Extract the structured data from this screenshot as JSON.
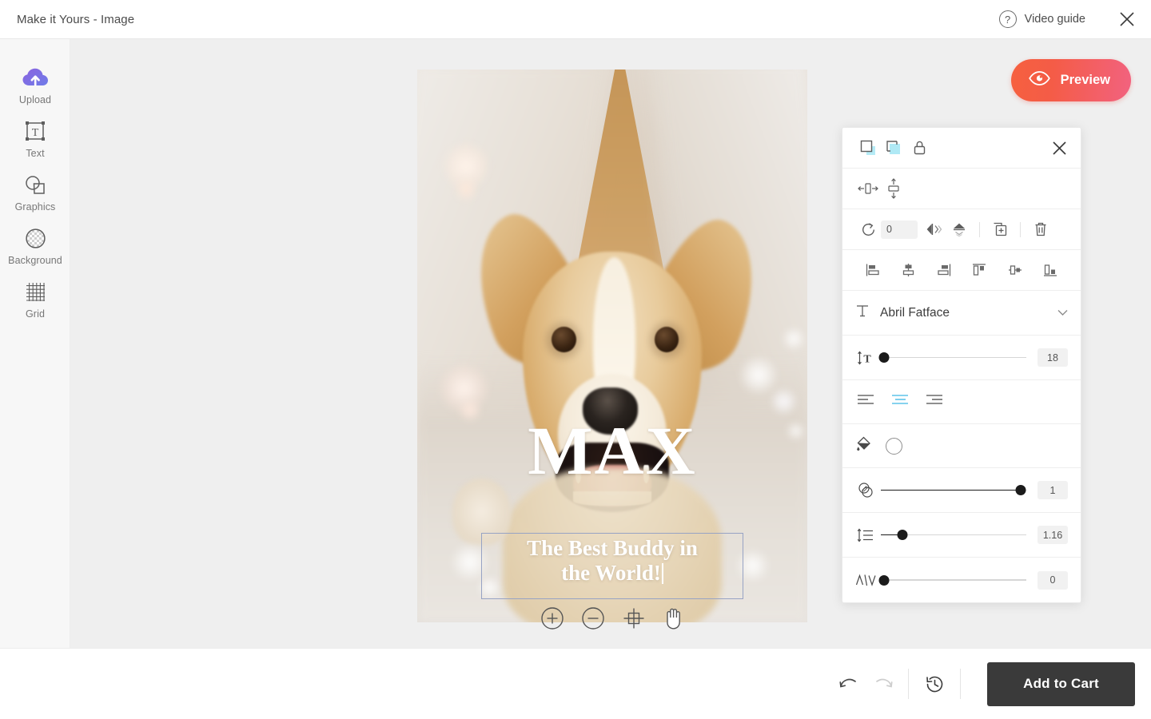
{
  "header": {
    "title": "Make it Yours - Image",
    "video_guide_label": "Video guide",
    "help_icon": "question-mark-icon",
    "close_icon": "close-icon"
  },
  "sidebar": {
    "items": [
      {
        "label": "Upload",
        "icon": "cloud-upload-icon"
      },
      {
        "label": "Text",
        "icon": "text-box-icon"
      },
      {
        "label": "Graphics",
        "icon": "shapes-icon"
      },
      {
        "label": "Background",
        "icon": "transparency-circle-icon"
      },
      {
        "label": "Grid",
        "icon": "grid-icon"
      }
    ]
  },
  "preview": {
    "label": "Preview",
    "icon": "eye-icon"
  },
  "canvas": {
    "image_alt": "corgi-dog-photo",
    "title_text": "MAX",
    "subtitle_line1": "The Best Buddy in",
    "subtitle_line2": "the World!",
    "selection_border_color": "#97a3c4",
    "tools": [
      {
        "name": "zoom-in-icon",
        "label": "+"
      },
      {
        "name": "zoom-out-icon",
        "label": "−"
      },
      {
        "name": "fit-canvas-icon",
        "label": ""
      },
      {
        "name": "pan-hand-icon",
        "label": ""
      }
    ]
  },
  "panel": {
    "close_icon": "close-icon",
    "mask_tools": [
      {
        "name": "crop-to-shape-icon"
      },
      {
        "name": "mask-image-icon"
      },
      {
        "name": "lock-icon"
      }
    ],
    "size_tools": [
      {
        "name": "fit-width-icon"
      },
      {
        "name": "fit-height-icon"
      }
    ],
    "transform": {
      "rotate_icon": "rotate-icon",
      "rotation_value": "0",
      "flip_horizontal_icon": "flip-horizontal-icon",
      "flip_vertical_icon": "flip-vertical-icon",
      "duplicate_icon": "duplicate-icon",
      "delete_icon": "trash-icon"
    },
    "align_tools": [
      {
        "name": "align-left-icon"
      },
      {
        "name": "align-center-horizontal-icon"
      },
      {
        "name": "align-right-icon"
      },
      {
        "name": "align-top-icon"
      },
      {
        "name": "align-middle-vertical-icon"
      },
      {
        "name": "align-bottom-icon"
      }
    ],
    "font": {
      "icon": "font-type-icon",
      "name": "Abril Fatface",
      "dropdown_icon": "chevron-down-icon"
    },
    "font_size": {
      "icon": "font-size-icon",
      "value": "18",
      "percent": 2
    },
    "text_align": {
      "options": [
        {
          "name": "text-align-left-icon",
          "active": false
        },
        {
          "name": "text-align-center-icon",
          "active": true
        },
        {
          "name": "text-align-right-icon",
          "active": false
        }
      ],
      "active_color": "#4db8e8"
    },
    "fill": {
      "bucket_icon": "paint-bucket-icon",
      "swatch_color": "#ffffff"
    },
    "opacity": {
      "icon": "opacity-icon",
      "value": "1",
      "percent": 96
    },
    "line_height": {
      "icon": "line-height-icon",
      "value": "1.16",
      "percent": 15
    },
    "letter_spacing": {
      "icon": "letter-spacing-icon",
      "value": "0",
      "percent": 2
    }
  },
  "footer": {
    "undo_icon": "undo-icon",
    "redo_icon": "redo-icon",
    "history_icon": "history-clock-icon",
    "add_to_cart_label": "Add to Cart"
  }
}
